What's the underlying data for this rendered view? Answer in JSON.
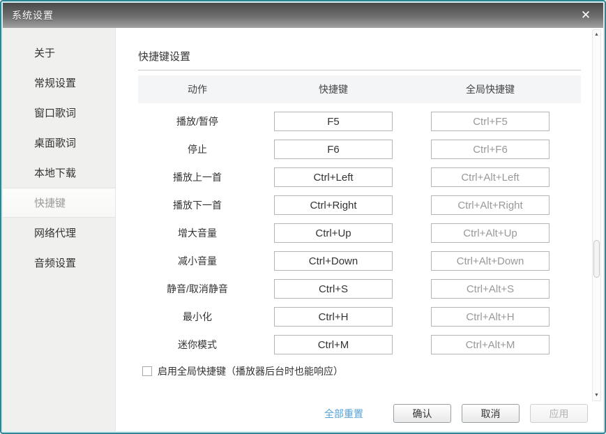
{
  "window": {
    "title": "系统设置",
    "close_glyph": "✕"
  },
  "sidebar": {
    "selected_index": 5,
    "items": [
      {
        "key": "about",
        "label": "关于"
      },
      {
        "key": "general",
        "label": "常规设置"
      },
      {
        "key": "window-lyrics",
        "label": "窗口歌词"
      },
      {
        "key": "desktop-lyrics",
        "label": "桌面歌词"
      },
      {
        "key": "local-download",
        "label": "本地下载"
      },
      {
        "key": "hotkeys",
        "label": "快捷键"
      },
      {
        "key": "network-proxy",
        "label": "网络代理"
      },
      {
        "key": "audio",
        "label": "音频设置"
      }
    ]
  },
  "content": {
    "section_title": "快捷键设置",
    "table": {
      "headers": [
        "动作",
        "快捷键",
        "全局快捷键"
      ],
      "rows": [
        {
          "key": "play-pause",
          "action": "播放/暂停",
          "hotkey": "F5",
          "global": "Ctrl+F5"
        },
        {
          "key": "stop",
          "action": "停止",
          "hotkey": "F6",
          "global": "Ctrl+F6"
        },
        {
          "key": "prev-track",
          "action": "播放上一首",
          "hotkey": "Ctrl+Left",
          "global": "Ctrl+Alt+Left"
        },
        {
          "key": "next-track",
          "action": "播放下一首",
          "hotkey": "Ctrl+Right",
          "global": "Ctrl+Alt+Right"
        },
        {
          "key": "volume-up",
          "action": "增大音量",
          "hotkey": "Ctrl+Up",
          "global": "Ctrl+Alt+Up"
        },
        {
          "key": "volume-down",
          "action": "减小音量",
          "hotkey": "Ctrl+Down",
          "global": "Ctrl+Alt+Down"
        },
        {
          "key": "mute",
          "action": "静音/取消静音",
          "hotkey": "Ctrl+S",
          "global": "Ctrl+Alt+S"
        },
        {
          "key": "minimize",
          "action": "最小化",
          "hotkey": "Ctrl+H",
          "global": "Ctrl+Alt+H"
        },
        {
          "key": "mini-mode",
          "action": "迷你模式",
          "hotkey": "Ctrl+M",
          "global": "Ctrl+Alt+M"
        }
      ]
    },
    "global_hotkey_checkbox": {
      "label": "启用全局快捷键（播放器后台时也能响应）",
      "checked": false
    }
  },
  "footer": {
    "reset_all_label": "全部重置",
    "confirm_label": "确认",
    "cancel_label": "取消",
    "apply_label": "应用",
    "apply_enabled": false
  },
  "scrollbar": {
    "up_glyph": "▲",
    "down_glyph": "▼"
  },
  "colors": {
    "window_border": "#2d8694",
    "titlebar_top": "#494949",
    "titlebar_bottom": "#a2a2a2",
    "sidebar_bg": "#f0f0ef",
    "selected_item_text": "#9a9a9a",
    "table_header_bg": "#f3f5f7",
    "input_border": "#b5b5b5",
    "global_hotkey_text": "#999999",
    "reset_link_blue": "#55a0d5"
  }
}
